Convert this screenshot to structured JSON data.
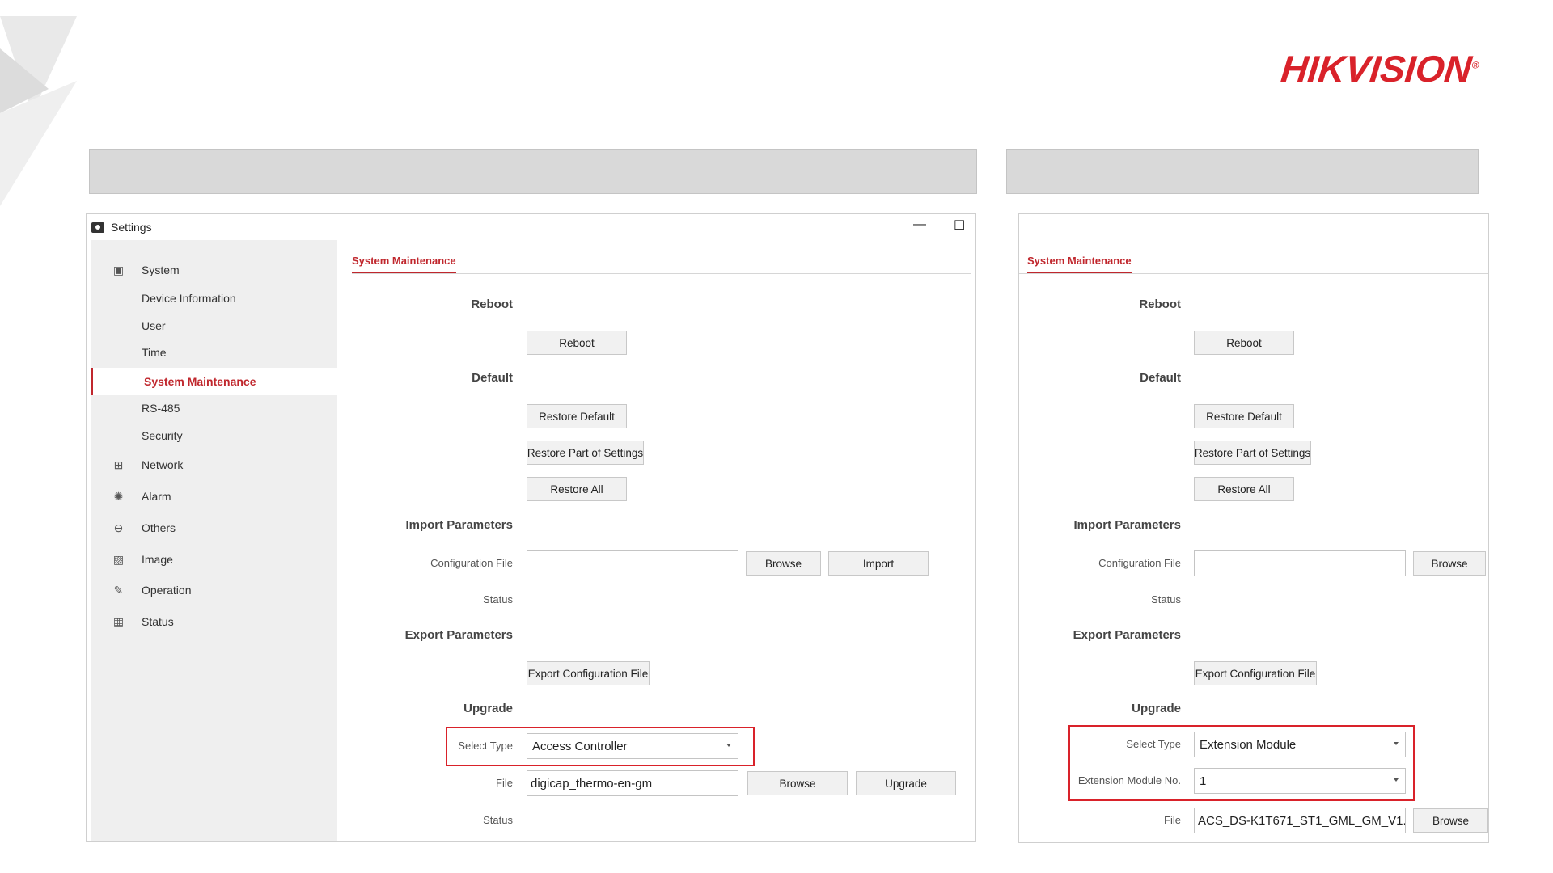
{
  "brand": {
    "logo_text": "HIKVISION",
    "reg_mark": "®",
    "accent": "#c0272d"
  },
  "left_window": {
    "title": "Settings",
    "minimize_glyph": "—",
    "maximize_glyph": "☐",
    "sidebar": {
      "items": [
        {
          "label": "System",
          "icon": "system-icon"
        },
        {
          "label": "Device Information"
        },
        {
          "label": "User"
        },
        {
          "label": "Time"
        },
        {
          "label": "System Maintenance",
          "active": true
        },
        {
          "label": "RS-485"
        },
        {
          "label": "Security"
        },
        {
          "label": "Network",
          "icon": "network-icon"
        },
        {
          "label": "Alarm",
          "icon": "alarm-icon"
        },
        {
          "label": "Others",
          "icon": "others-icon"
        },
        {
          "label": "Image",
          "icon": "image-icon"
        },
        {
          "label": "Operation",
          "icon": "wrench-icon"
        },
        {
          "label": "Status",
          "icon": "status-icon"
        }
      ]
    },
    "tab": "System Maintenance",
    "reboot": {
      "heading": "Reboot",
      "button": "Reboot"
    },
    "default": {
      "heading": "Default",
      "restore_default": "Restore Default",
      "restore_part": "Restore Part of Settings",
      "restore_all": "Restore All"
    },
    "import": {
      "heading": "Import Parameters",
      "config_label": "Configuration File",
      "config_value": "",
      "browse": "Browse",
      "import": "Import",
      "status_label": "Status"
    },
    "export": {
      "heading": "Export Parameters",
      "export_button": "Export Configuration File"
    },
    "upgrade": {
      "heading": "Upgrade",
      "select_type_label": "Select Type",
      "select_type_value": "Access Controller",
      "file_label": "File",
      "file_value": "digicap_thermo-en-gm",
      "browse": "Browse",
      "upgrade": "Upgrade",
      "status_label": "Status"
    }
  },
  "right_window": {
    "tab": "System Maintenance",
    "reboot": {
      "heading": "Reboot",
      "button": "Reboot"
    },
    "default": {
      "heading": "Default",
      "restore_default": "Restore Default",
      "restore_part": "Restore Part of Settings",
      "restore_all": "Restore All"
    },
    "import": {
      "heading": "Import Parameters",
      "config_label": "Configuration File",
      "config_value": "",
      "browse": "Browse",
      "status_label": "Status"
    },
    "export": {
      "heading": "Export Parameters",
      "export_button": "Export Configuration File"
    },
    "upgrade": {
      "heading": "Upgrade",
      "select_type_label": "Select Type",
      "select_type_value": "Extension Module",
      "ext_no_label": "Extension Module No.",
      "ext_no_value": "1",
      "file_label": "File",
      "file_value": "ACS_DS-K1T671_ST1_GML_GM_V1.",
      "browse": "Browse"
    }
  }
}
